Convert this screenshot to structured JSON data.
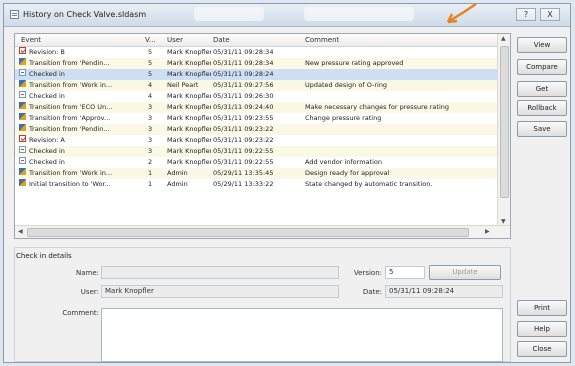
{
  "window": {
    "title": "History on Check Valve.sldasm"
  },
  "titlebar": {
    "help_label": "?",
    "close_label": "X"
  },
  "columns": {
    "event": "Event",
    "version": "V...",
    "user": "User",
    "date": "Date",
    "comment": "Comment"
  },
  "rows": [
    {
      "icon": "revision-icon",
      "event": "Revision: B",
      "version": "5",
      "user": "Mark Knopfler",
      "date": "05/31/11 09:28:34",
      "comment": ""
    },
    {
      "icon": "transition-icon",
      "event": "Transition from 'Pendin...",
      "version": "5",
      "user": "Mark Knopfler",
      "date": "05/31/11 09:28:34",
      "comment": "New pressure rating approved"
    },
    {
      "icon": "checkin-icon",
      "event": "Checked in",
      "version": "5",
      "user": "Mark Knopfler",
      "date": "05/31/11 09:28:24",
      "comment": ""
    },
    {
      "icon": "transition-icon",
      "event": "Transition from 'Work in...",
      "version": "4",
      "user": "Neil Peart",
      "date": "05/31/11 09:27:56",
      "comment": "Updated design of O-ring"
    },
    {
      "icon": "checkin-icon",
      "event": "Checked in",
      "version": "4",
      "user": "Mark Knopfler",
      "date": "05/31/11 09:26:30",
      "comment": ""
    },
    {
      "icon": "transition-icon",
      "event": "Transition from 'ECO Un...",
      "version": "3",
      "user": "Mark Knopfler",
      "date": "05/31/11 09:24:40",
      "comment": "Make necessary changes for pressure rating"
    },
    {
      "icon": "transition-icon",
      "event": "Transition from 'Approv...",
      "version": "3",
      "user": "Mark Knopfler",
      "date": "05/31/11 09:23:55",
      "comment": "Change pressure rating"
    },
    {
      "icon": "transition-icon",
      "event": "Transition from 'Pendin...",
      "version": "3",
      "user": "Mark Knopfler",
      "date": "05/31/11 09:23:22",
      "comment": ""
    },
    {
      "icon": "revision-icon",
      "event": "Revision: A",
      "version": "3",
      "user": "Mark Knopfler",
      "date": "05/31/11 09:23:22",
      "comment": ""
    },
    {
      "icon": "checkin-icon",
      "event": "Checked in",
      "version": "3",
      "user": "Mark Knopfler",
      "date": "05/31/11 09:22:55",
      "comment": ""
    },
    {
      "icon": "checkin-icon",
      "event": "Checked in",
      "version": "2",
      "user": "Mark Knopfler",
      "date": "05/31/11 09:22:55",
      "comment": "Add vendor information"
    },
    {
      "icon": "transition-icon",
      "event": "Transition from 'Work in...",
      "version": "1",
      "user": "Admin",
      "date": "05/29/11 13:35:45",
      "comment": "Design ready for approval"
    },
    {
      "icon": "transition-icon",
      "event": "Initial transition to 'Wor...",
      "version": "1",
      "user": "Admin",
      "date": "05/29/11 13:33:22",
      "comment": "State changed by automatic transition."
    }
  ],
  "buttons": {
    "view": "View",
    "compare": "Compare",
    "get": "Get",
    "rollback": "Rollback",
    "save": "Save",
    "print": "Print",
    "help": "Help",
    "close": "Close",
    "update": "Update"
  },
  "details": {
    "group_label": "Check in details",
    "name_label": "Name:",
    "name_value": "",
    "version_label": "Version:",
    "version_value": "5",
    "user_label": "User:",
    "user_value": "Mark Knopfler",
    "date_label": "Date:",
    "date_value": "05/31/11 09:28:24",
    "comment_label": "Comment:",
    "comment_value": ""
  },
  "colors": {
    "alt_row": "#fbf8e6",
    "accent_arrow": "#e8821e",
    "revision_icon": "#c03a2b",
    "transition_icon": "#3b6fb6"
  }
}
